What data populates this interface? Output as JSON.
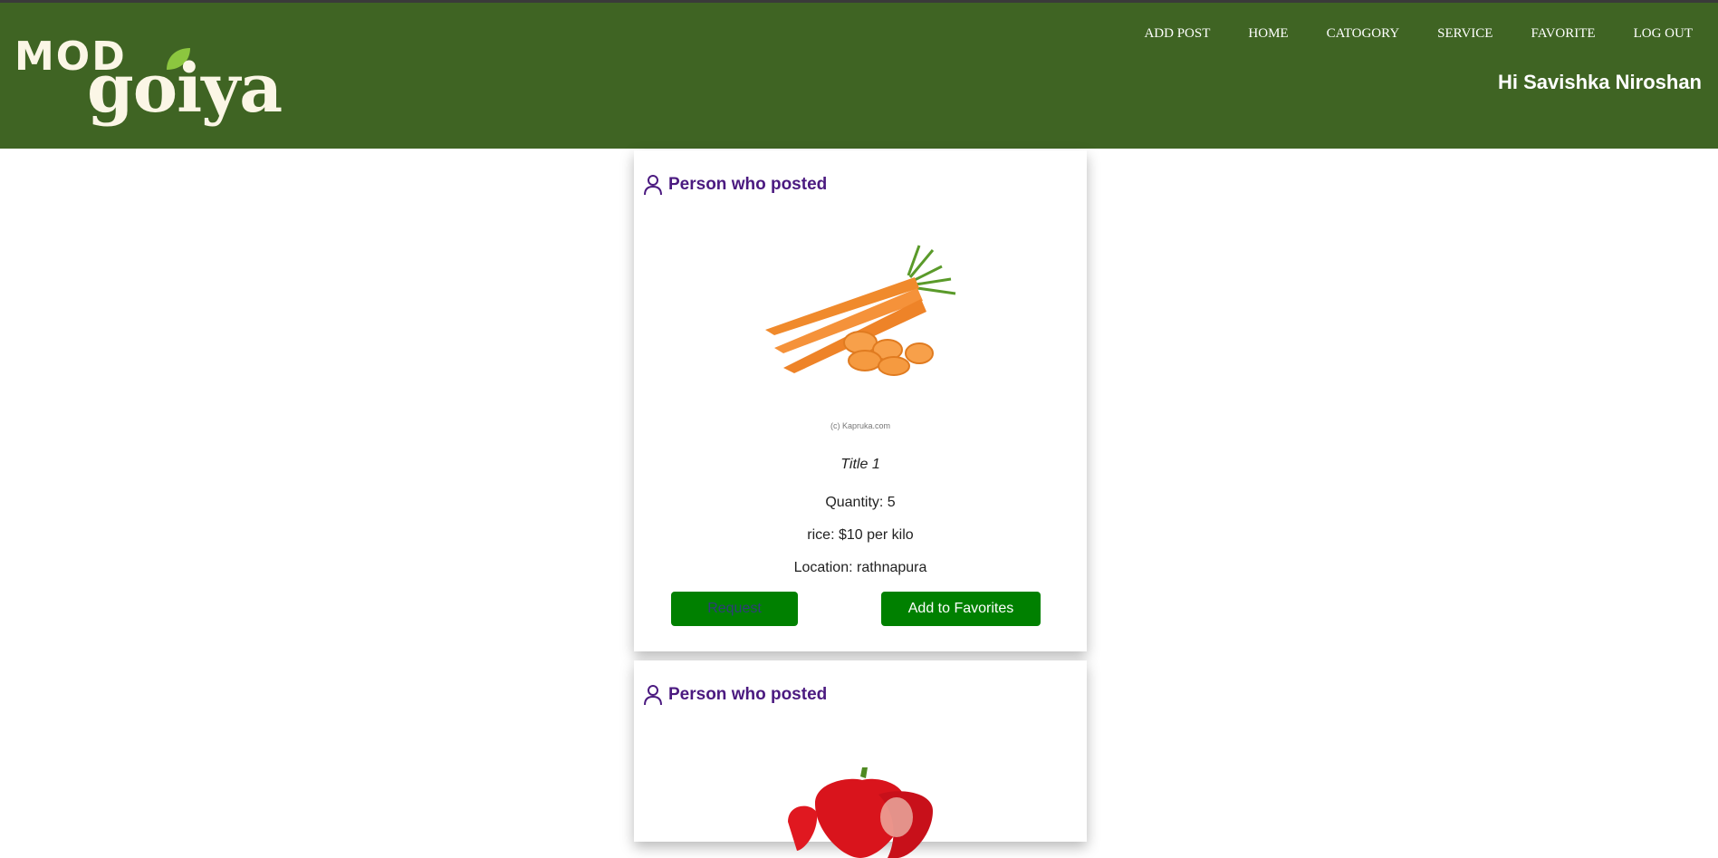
{
  "header": {
    "logo_mod": "MOD",
    "logo_goiya": "goiya",
    "nav": [
      "ADD POST",
      "HOME",
      "CATOGORY",
      "SERVICE",
      "FAVORITE",
      "LOG OUT"
    ],
    "greeting": "Hi Savishka Niroshan",
    "background_color": "#3f6423"
  },
  "posts": [
    {
      "poster": "Person who posted",
      "image": "carrots",
      "image_watermark": "(c) Kapruka.com",
      "title": "Title 1",
      "quantity": "Quantity: 5",
      "price": "rice: $10 per kilo",
      "location": "Location: rathnapura",
      "request_label": "Request",
      "favorite_label": "Add to Favorites"
    },
    {
      "poster": "Person who posted",
      "image": "red-bell-pepper"
    }
  ],
  "colors": {
    "button": "#008000",
    "poster_name": "#4b1a80"
  }
}
